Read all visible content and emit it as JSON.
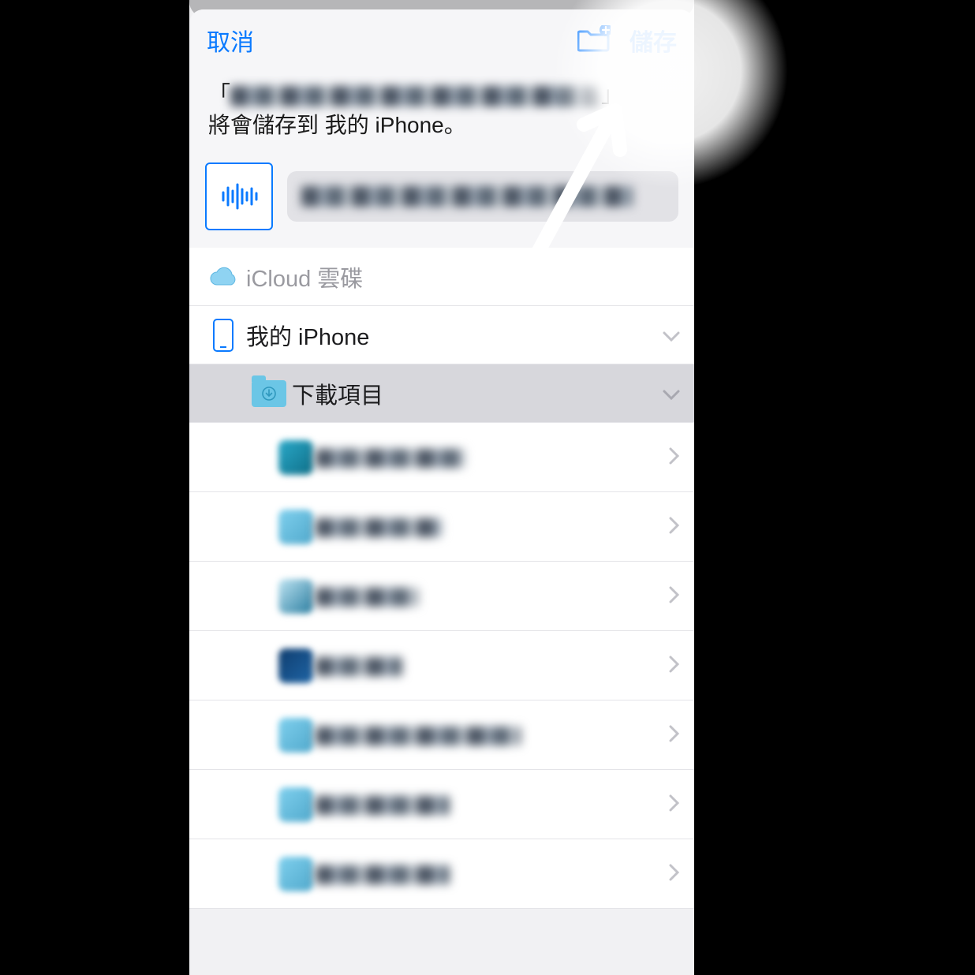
{
  "nav": {
    "cancel": "取消",
    "save": "儲存"
  },
  "desc": {
    "quote_open": "「",
    "quote_close": "」",
    "line2": "將會儲存到 我的 iPhone。"
  },
  "locations": {
    "icloud": "iCloud 雲碟",
    "on_my_iphone": "我的 iPhone",
    "downloads": "下載項目"
  },
  "colors": {
    "accent": "#0a7aff"
  },
  "child_app_colors": [
    "linear-gradient(135deg,#2aa9c9,#0f6f88)",
    "linear-gradient(135deg,#7fd0ee,#51a9cc)",
    "linear-gradient(135deg,#bfe5f3,#2a7da0)",
    "linear-gradient(135deg,#0f3d6e,#1f65a6)",
    "linear-gradient(135deg,#7fd0ee,#51a9cc)",
    "linear-gradient(135deg,#7fd0ee,#51a9cc)",
    "linear-gradient(135deg,#7fd0ee,#51a9cc)"
  ]
}
